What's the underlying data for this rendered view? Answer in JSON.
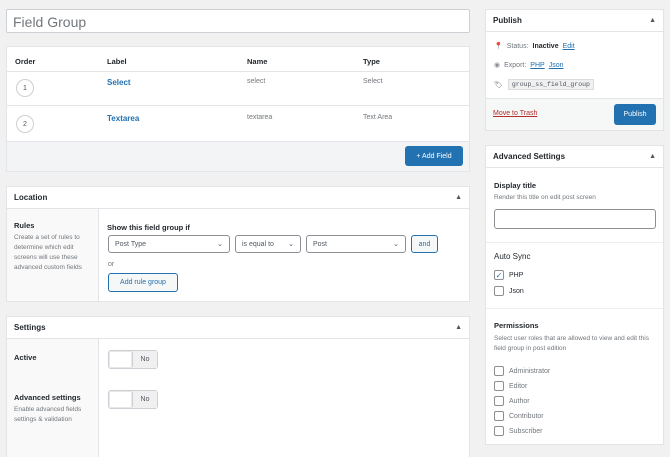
{
  "title_placeholder": "Field Group",
  "fields": {
    "headers": {
      "order": "Order",
      "label": "Label",
      "name": "Name",
      "type": "Type"
    },
    "rows": [
      {
        "order": "1",
        "label": "Select",
        "name": "select",
        "type": "Select"
      },
      {
        "order": "2",
        "label": "Textarea",
        "name": "textarea",
        "type": "Text Area"
      }
    ],
    "add_field": "+ Add Field"
  },
  "location": {
    "title": "Location",
    "rules_label": "Rules",
    "rules_desc": "Create a set of rules to determine which edit screens will use these advanced custom fields",
    "show_if": "Show this field group if",
    "param": "Post Type",
    "operator": "is equal to",
    "value": "Post",
    "and": "and",
    "or": "or",
    "add_rule_group": "Add rule group"
  },
  "settings": {
    "title": "Settings",
    "active_label": "Active",
    "active_toggle": "No",
    "advanced_label": "Advanced settings",
    "advanced_desc": "Enable advanced fields settings & validation",
    "advanced_toggle": "No"
  },
  "publish": {
    "title": "Publish",
    "status_label": "Status:",
    "status_value": "Inactive",
    "status_edit": "Edit",
    "export_label": "Export:",
    "export_php": "PHP",
    "export_json": "Json",
    "key": "group_ss_field_group",
    "trash": "Move to Trash",
    "publish_btn": "Publish"
  },
  "advanced_settings": {
    "title": "Advanced Settings",
    "display_title_label": "Display title",
    "display_title_desc": "Render this title on edit post screen",
    "auto_sync_label": "Auto Sync",
    "sync_options": [
      {
        "label": "PHP",
        "checked": true
      },
      {
        "label": "Json",
        "checked": false
      }
    ],
    "permissions_label": "Permissions",
    "permissions_desc": "Select user roles that are allowed to view and edit this field group in post edition",
    "roles": [
      "Administrator",
      "Editor",
      "Author",
      "Contributor",
      "Subscriber"
    ]
  },
  "colors": {
    "accent": "#2271b1",
    "trash": "#b32d2e"
  }
}
